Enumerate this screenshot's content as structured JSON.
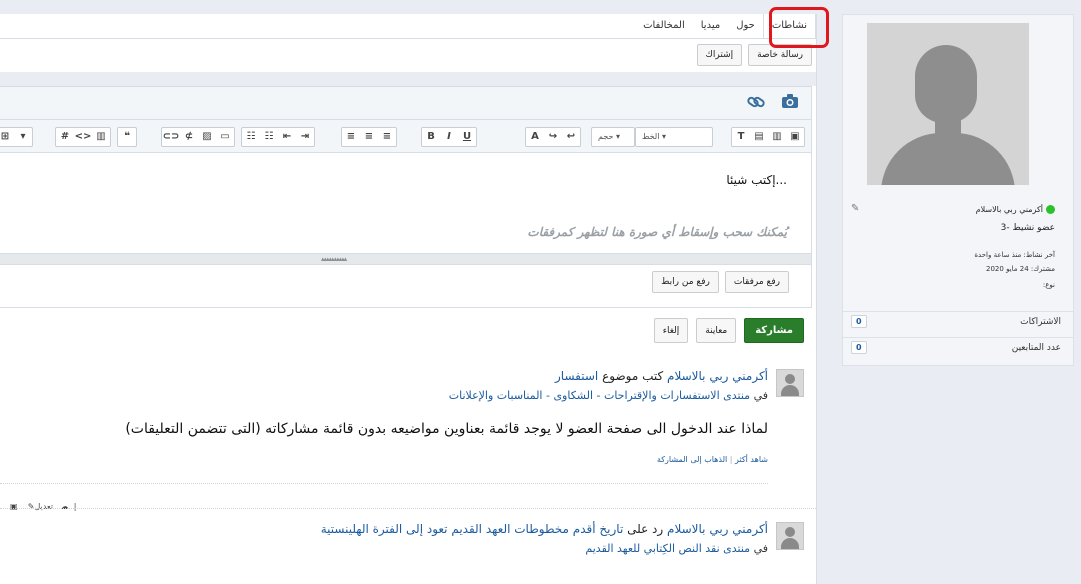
{
  "tabs": [
    "نشاطات",
    "حول",
    "ميديا",
    "المخالفات"
  ],
  "top_buttons": [
    "رسالة خاصة",
    "إشتراك"
  ],
  "editor": {
    "font_select": "الخط",
    "size_select": "حجم",
    "placeholder_text": "إكتب شيئا...",
    "drop_hint": "يُمكنك سحب وإسقاط أي صورة هنا لتظهر كمرفقات",
    "attach_upload": "رفع مرفقات",
    "attach_link": "رفع من رابط"
  },
  "actions": {
    "share": "مشاركة",
    "preview": "معاينة",
    "cancel": "إلغاء"
  },
  "feed": [
    {
      "user": "أكرمني ربي بالاسلام",
      "verb": "كتب موضوع",
      "topic": "استفسار",
      "in_prefix": "في",
      "forum": "منتدى الاستفسارات والإقتراحات - الشكاوى - المناسبات والإعلانات",
      "title": "لماذا عند الدخول الى صفحة العضو لا يوجد قائمة بعناوين مواضيعه بدون قائمة مشاركاته (التى تتضمن التعليقات)",
      "more": "شاهد أكثر",
      "goto": "الذهاب إلى المشاركة",
      "edit": "تعديل"
    },
    {
      "user": "أكرمني ربي بالاسلام",
      "verb": "رد على",
      "topic": "تاريخ أقدم مخطوطات العهد القديم تعود إلى الفترة الهلينستية",
      "in_prefix": "في",
      "forum": "منتدى نقد النص الكِتابي للعهد القديم"
    }
  ],
  "sidebar": {
    "name": "أكرمني ربي بالاسلام",
    "rank": "3- عضو نشيط",
    "last_activity": "آخر نشاط: منذ ساعة واحدة",
    "joined": "مشترك: 24 مايو 2020",
    "type": "نوع:",
    "subscriptions_label": "الاشتراكات",
    "subscriptions_count": "0",
    "followers_label": "عدد المتابعين",
    "followers_count": "0"
  }
}
